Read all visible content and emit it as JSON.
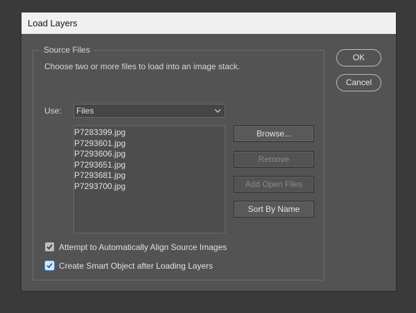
{
  "window": {
    "title": "Load Layers"
  },
  "source_files": {
    "group_label": "Source Files",
    "description": "Choose two or more files to load into an image stack.",
    "use_label": "Use:",
    "use_value": "Files",
    "files": [
      "P7283399.jpg",
      "P7293601.jpg",
      "P7293606.jpg",
      "P7293651.jpg",
      "P7293681.jpg",
      "P7293700.jpg"
    ],
    "buttons": {
      "browse": "Browse...",
      "remove": "Remove",
      "add_open_files": "Add Open Files",
      "sort_by_name": "Sort By Name"
    }
  },
  "options": {
    "align": {
      "label": "Attempt to Automatically Align Source Images",
      "checked": true
    },
    "smart_object": {
      "label": "Create Smart Object after Loading Layers",
      "checked": true
    }
  },
  "dialog_buttons": {
    "ok": "OK",
    "cancel": "Cancel"
  }
}
